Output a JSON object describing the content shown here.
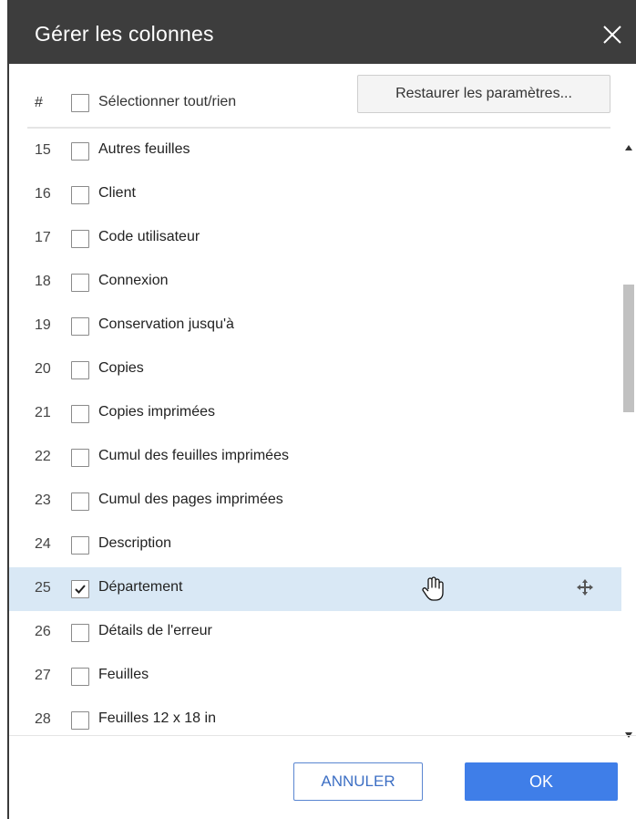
{
  "dialog": {
    "title": "Gérer les colonnes",
    "close_icon": "close-icon"
  },
  "header": {
    "hash": "#",
    "select_all_label": "Sélectionner tout/rien",
    "select_all_checked": false,
    "restore_button": "Restaurer les paramètres..."
  },
  "columns": [
    {
      "num": "15",
      "label": "Autres feuilles",
      "checked": false
    },
    {
      "num": "16",
      "label": "Client",
      "checked": false
    },
    {
      "num": "17",
      "label": "Code utilisateur",
      "checked": false
    },
    {
      "num": "18",
      "label": "Connexion",
      "checked": false
    },
    {
      "num": "19",
      "label": "Conservation jusqu'à",
      "checked": false
    },
    {
      "num": "20",
      "label": "Copies",
      "checked": false
    },
    {
      "num": "21",
      "label": "Copies imprimées",
      "checked": false
    },
    {
      "num": "22",
      "label": "Cumul des feuilles imprimées",
      "checked": false
    },
    {
      "num": "23",
      "label": "Cumul des pages imprimées",
      "checked": false
    },
    {
      "num": "24",
      "label": "Description",
      "checked": false
    },
    {
      "num": "25",
      "label": "Département",
      "checked": true,
      "selected": true
    },
    {
      "num": "26",
      "label": "Détails de l'erreur",
      "checked": false
    },
    {
      "num": "27",
      "label": "Feuilles",
      "checked": false
    },
    {
      "num": "28",
      "label": "Feuilles 12 x 18 in",
      "checked": false
    }
  ],
  "footer": {
    "cancel_label": "ANNULER",
    "ok_label": "OK"
  },
  "colors": {
    "titlebar": "#3d3d3d",
    "selected_row": "#d9e8f5",
    "primary": "#3f7ee8"
  }
}
